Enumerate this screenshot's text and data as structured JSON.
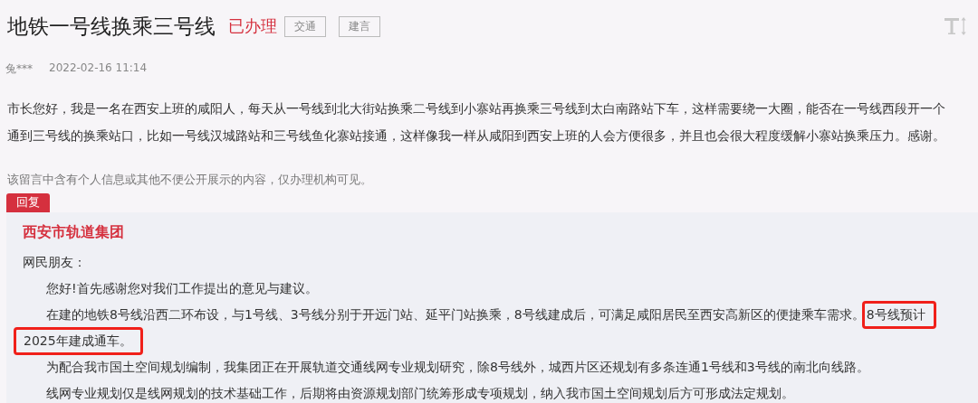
{
  "title": "地铁一号线换乘三号线",
  "status": "已办理",
  "tags": [
    "交通",
    "建言"
  ],
  "author": "兔***",
  "date": "2022-02-16 11:14",
  "message_lines": [
    "市长您好，我是一名在西安上班的咸阳人，每天从一号线到北大街站换乘二号线到小寨站再换乘三号线到太白南路站下车，这样需要绕一大圈，能否在一号线西段开一个",
    "通到三号线的换乘站口，比如一号线汉城路站和三号线鱼化寨站接通，这样像我一样从咸阳到西安上班的人会方便很多，并且也会很大程度缓解小寨站换乘压力。感谢。"
  ],
  "privacy_note": "该留言中含有个人信息或其他不便公开展示的内容，仅办理机构可见。",
  "reply": {
    "tab": "回复",
    "organization": "西安市轨道集团",
    "greeting": "网民朋友：",
    "lines": [
      {
        "indent": true,
        "segments": [
          {
            "text": "您好!首先感谢您对我们工作提出的意见与建议。",
            "highlighted": false
          }
        ]
      },
      {
        "indent": true,
        "segments": [
          {
            "text": "在建的地铁8号线沿西二环布设，与1号线、3号线分别于开远门站、延平门站换乘，8号线建成后，可满足咸阳居民至西安高新区的便捷乘车需求。",
            "highlighted": false
          },
          {
            "text": "8号线预计",
            "highlighted": true
          }
        ]
      },
      {
        "indent": false,
        "segments": [
          {
            "text": "2025年建成通车。",
            "highlighted": true
          }
        ]
      },
      {
        "indent": true,
        "segments": [
          {
            "text": "为配合我市国土空间规划编制，我集团正在开展轨道交通线网专业规划研究，除8号线外，城西片区还规划有多条连通1号线和3号线的南北向线路。",
            "highlighted": false
          }
        ]
      },
      {
        "indent": true,
        "segments": [
          {
            "text": "线网专业规划仅是线网规划的技术基础工作，后期将由资源规划部门统筹形成专项规划，纳入我市国土空间规划后方可形成法定规划。",
            "highlighted": false
          }
        ]
      }
    ]
  }
}
